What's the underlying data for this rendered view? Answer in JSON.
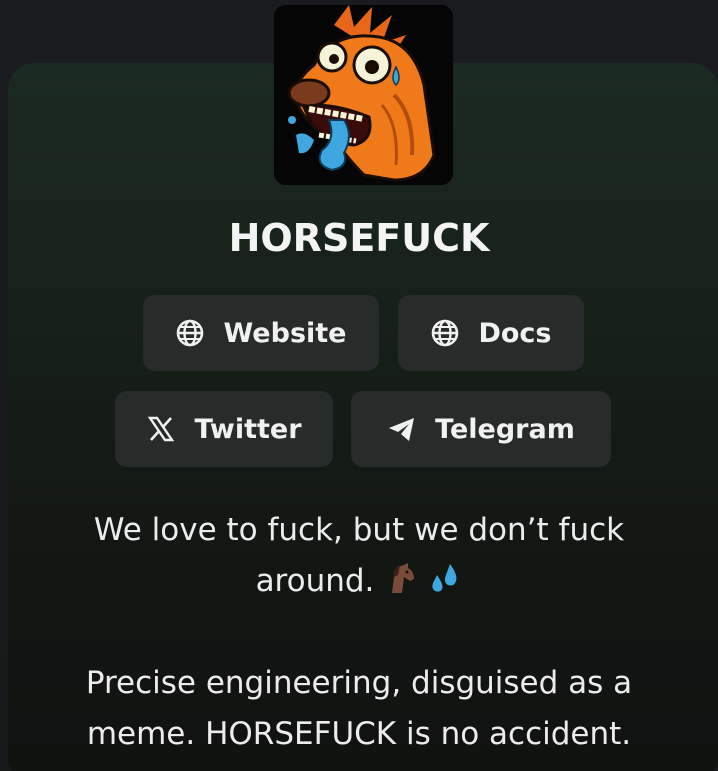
{
  "profile": {
    "name": "HORSEFUCK",
    "avatar_icon": "cartoon-horse-avatar"
  },
  "links": [
    {
      "label": "Website",
      "icon": "globe-icon"
    },
    {
      "label": "Docs",
      "icon": "globe-icon"
    },
    {
      "label": "Twitter",
      "icon": "x-logo-icon"
    },
    {
      "label": "Telegram",
      "icon": "telegram-plane-icon"
    }
  ],
  "bio": {
    "line1": "We love to fuck, but we don’t fuck around.",
    "emojis": [
      "horse-emoji",
      "sweat-droplets-emoji"
    ],
    "line2": "Precise engineering, disguised as a meme. HORSEFUCK is no accident."
  },
  "colors": {
    "background": "#1b1b1f",
    "card_top": "#1b2a22",
    "button_bg": "#272b29",
    "text": "#f1f1f1",
    "horse_orange": "#f07a1a",
    "drool_blue": "#3fa7e0"
  }
}
